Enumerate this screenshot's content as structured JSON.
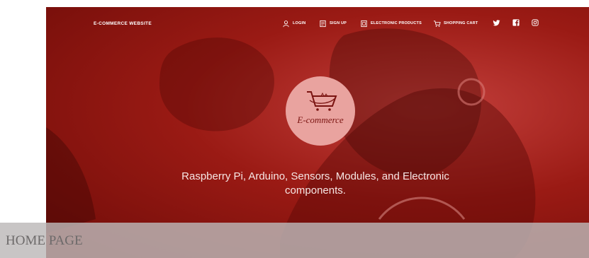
{
  "header": {
    "brand": "E-COMMERCE WEBSITE",
    "nav": [
      {
        "label": "LOGIN",
        "icon": "user-icon"
      },
      {
        "label": "SIGN UP",
        "icon": "signup-icon"
      },
      {
        "label": "ELECTRONIC PRODUCTS",
        "icon": "product-icon"
      },
      {
        "label": "SHOPPING CART",
        "icon": "cart-icon"
      }
    ],
    "social": [
      "twitter-icon",
      "facebook-icon",
      "instagram-icon"
    ]
  },
  "logo": {
    "text": "E-commerce"
  },
  "hero": {
    "tagline_line1": "Raspberry Pi, Arduino, Sensors, Modules, and Electronic",
    "tagline_line2": "components."
  },
  "page_label": "HOME PAGE",
  "colors": {
    "hero_red": "#9a1a14",
    "logo_pink": "#e9a39f",
    "band_gray": "#bcb8b8"
  }
}
